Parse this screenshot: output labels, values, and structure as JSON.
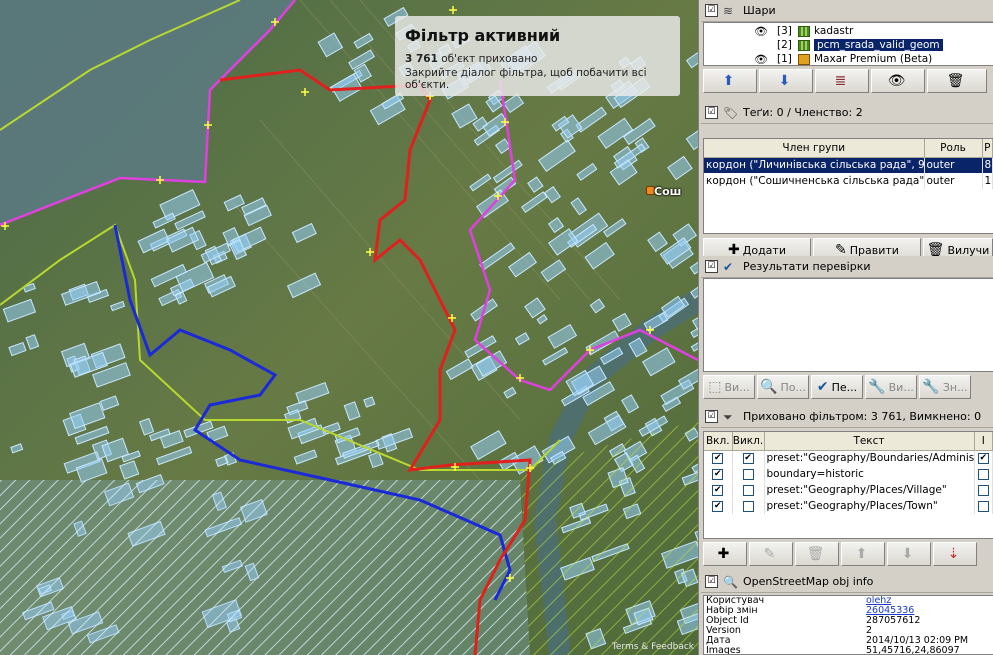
{
  "map": {
    "toast": {
      "title": "Фільтр активний",
      "count": "3 761",
      "hidden_text": "об'єкт приховано",
      "hint": "Закрийте діалог фільтра, щоб побачити всі об'єкти."
    },
    "place_label": "Сош",
    "attribution": "Terms & Feedback",
    "colors": {
      "red_route": "#e0201c",
      "blue_route": "#1a2ad8",
      "magenta_border": "#e040e0",
      "yellow_line": "#b8d830",
      "parcel": "#9fd0f0"
    }
  },
  "layers": {
    "title": "Шари",
    "items": [
      {
        "index": "[3]",
        "name": "kadastr",
        "visible": true,
        "selected": false
      },
      {
        "index": "[2]",
        "name": "pcm_srada_valid_geom",
        "visible": false,
        "selected": true
      },
      {
        "index": "[1]",
        "name": "Maxar Premium (Beta)",
        "visible": true,
        "selected": false
      }
    ],
    "buttons": [
      "arrow-up-icon",
      "arrow-down-icon",
      "merge-layers-icon",
      "eye-icon",
      "delete-icon"
    ]
  },
  "tags": {
    "title": "Теґи: 0 / Членство: 2",
    "columns": [
      "Член групи",
      "Роль",
      "P"
    ],
    "rows": [
      {
        "member": "кордон (\"Личинівська сільська рада\", 9 ...",
        "role": "outer",
        "pos": "8",
        "selected": true
      },
      {
        "member": "кордон (\"Сошичненська сільська рада\", ...",
        "role": "outer",
        "pos": "1",
        "selected": false
      }
    ],
    "buttons": {
      "add": "Додати",
      "edit": "Правити",
      "delete": "Вилучи"
    }
  },
  "validation": {
    "title": "Результати перевірки",
    "buttons": [
      "Ви...",
      "По...",
      "Пе...",
      "Ви...",
      "Зн..."
    ]
  },
  "filter": {
    "title": "Приховано фільтром: 3 761, Вимкнено: 0",
    "columns": [
      "Вкл.",
      "Викл.",
      "Текст",
      "I"
    ],
    "rows": [
      {
        "on": true,
        "off": true,
        "text": "preset:\"Geography/Boundaries/Adminis...",
        "i": true
      },
      {
        "on": true,
        "off": false,
        "text": "boundary=historic",
        "i": false
      },
      {
        "on": true,
        "off": false,
        "text": "preset:\"Geography/Places/Village\"",
        "i": false
      },
      {
        "on": true,
        "off": false,
        "text": "preset:\"Geography/Places/Town\"",
        "i": false
      }
    ]
  },
  "objinfo": {
    "title": "OpenStreetMap obj info",
    "rows": [
      {
        "label": "Користувач",
        "value": "olehz",
        "link": true
      },
      {
        "label": "Набір змін",
        "value": "26045336",
        "link": true
      },
      {
        "label": "Object Id",
        "value": "287057612",
        "link": false
      },
      {
        "label": "Version",
        "value": "2",
        "link": false
      },
      {
        "label": "Дата",
        "value": "2014/10/13 02:09 PM",
        "link": false
      },
      {
        "label": "Images",
        "value": "51,45716,24,86097",
        "link": false
      }
    ]
  }
}
